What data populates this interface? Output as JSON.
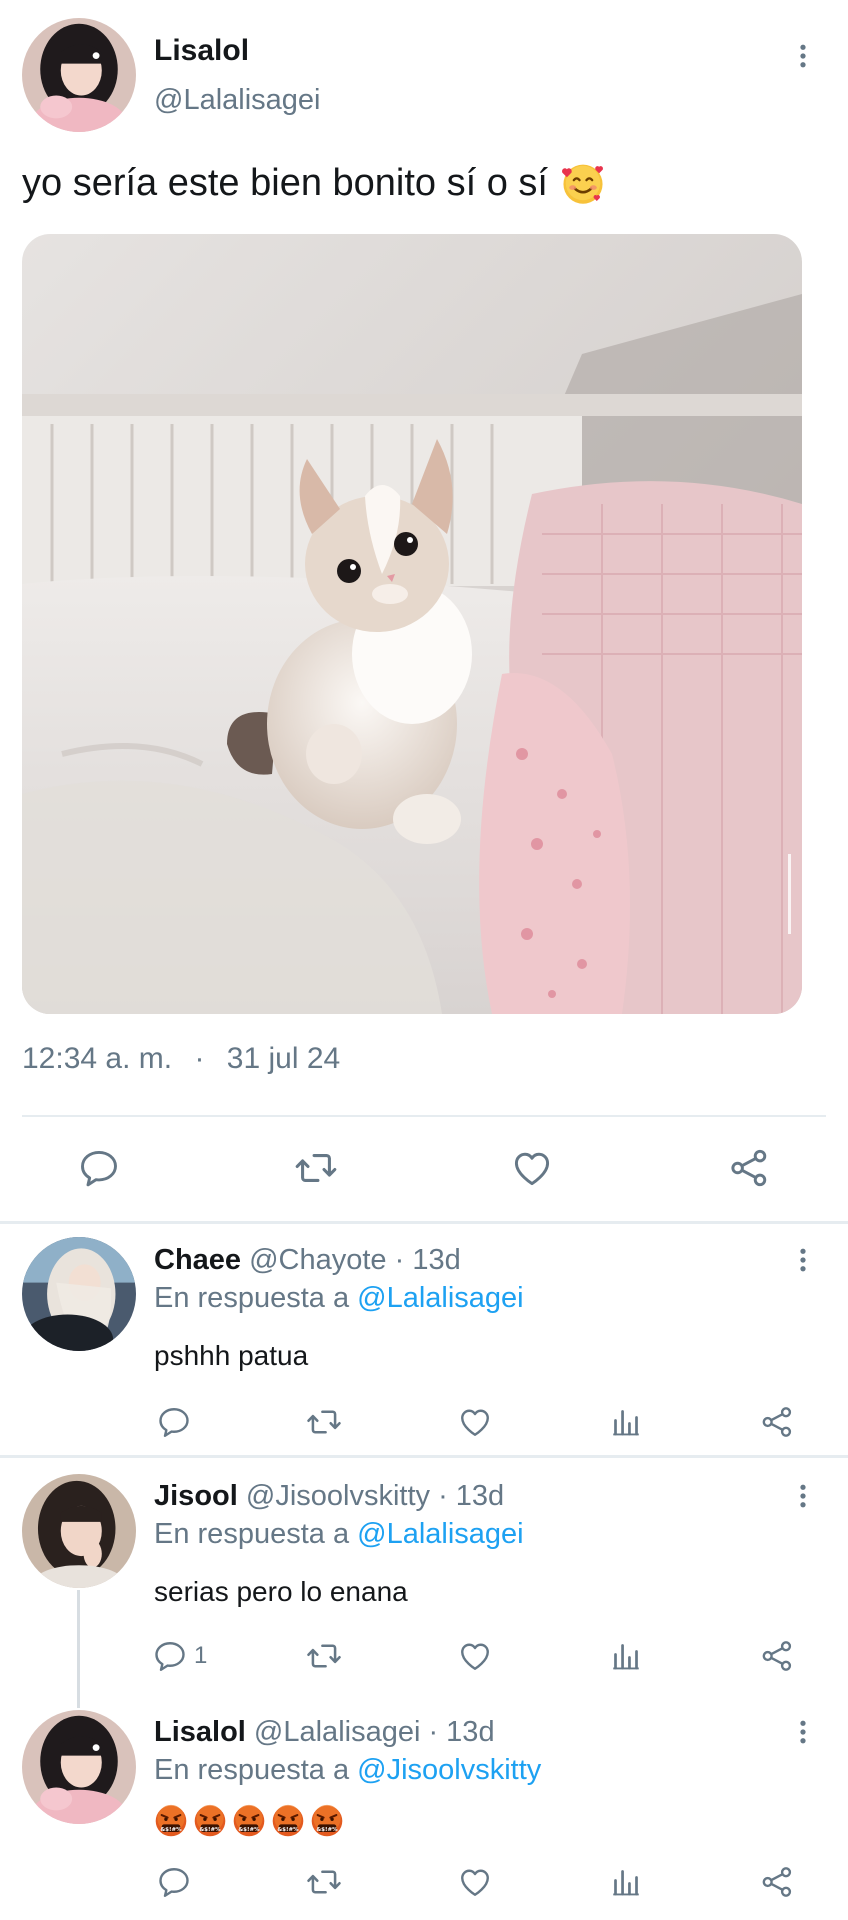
{
  "main_tweet": {
    "name": "Lisalol",
    "handle": "@Lalalisagei",
    "text": "yo sería este bien bonito sí o sí",
    "emoji": "smiling-face-with-hearts",
    "time": "12:34 a. m.",
    "separator": "·",
    "date": "31 jul 24"
  },
  "replies": [
    {
      "name": "Chaee",
      "handle": "@Chayote",
      "time": "· 13d",
      "reply_prefix": "En respuesta a",
      "reply_to": "@Lalalisagei",
      "text": "pshhh patua",
      "reply_count": ""
    },
    {
      "name": "Jisool",
      "handle": "@Jisoolvskitty",
      "time": "· 13d",
      "reply_prefix": "En respuesta a",
      "reply_to": "@Lalalisagei",
      "text": "serias pero lo enana",
      "reply_count": "1"
    },
    {
      "name": "Lisalol",
      "handle": "@Lalalisagei",
      "time": "· 13d",
      "reply_prefix": "En respuesta a",
      "reply_to": "@Jisoolvskitty",
      "text": "",
      "emoji_count": 5,
      "emoji": "face-with-symbols-on-mouth",
      "reply_count": ""
    }
  ],
  "colors": {
    "link": "#1da1f2",
    "secondary_text": "#657786",
    "primary_text": "#14171a",
    "icon": "#657786"
  }
}
